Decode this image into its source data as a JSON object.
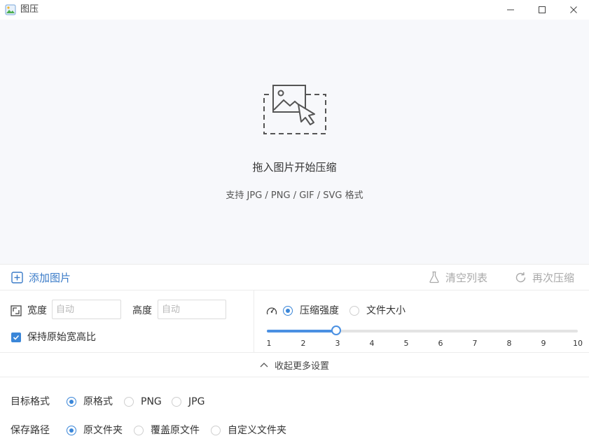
{
  "window": {
    "title": "图压"
  },
  "dropzone": {
    "title": "拖入图片开始压缩",
    "subtitle": "支持 JPG / PNG / GIF / SVG 格式"
  },
  "toolbar": {
    "add_label": "添加图片",
    "clear_label": "清空列表",
    "recompress_label": "再次压缩"
  },
  "size": {
    "width_label": "宽度",
    "width_placeholder": "自动",
    "height_label": "高度",
    "height_placeholder": "自动",
    "keep_ratio_label": "保持原始宽高比",
    "keep_ratio_checked": true
  },
  "compression": {
    "mode_strength_label": "压缩强度",
    "mode_filesize_label": "文件大小",
    "selected_mode": "strength",
    "min": 1,
    "max": 10,
    "value": 3,
    "ticks": [
      "1",
      "2",
      "3",
      "4",
      "5",
      "6",
      "7",
      "8",
      "9",
      "10"
    ]
  },
  "collapse": {
    "label": "收起更多设置"
  },
  "target_format": {
    "label": "目标格式",
    "options": [
      "原格式",
      "PNG",
      "JPG"
    ],
    "selected": 0
  },
  "save_path": {
    "label": "保存路径",
    "options": [
      "原文件夹",
      "覆盖原文件",
      "自定义文件夹"
    ],
    "selected": 0
  },
  "colors": {
    "accent": "#3a86d8",
    "link": "#3a7bc8",
    "disabled": "#a9a9a9"
  }
}
